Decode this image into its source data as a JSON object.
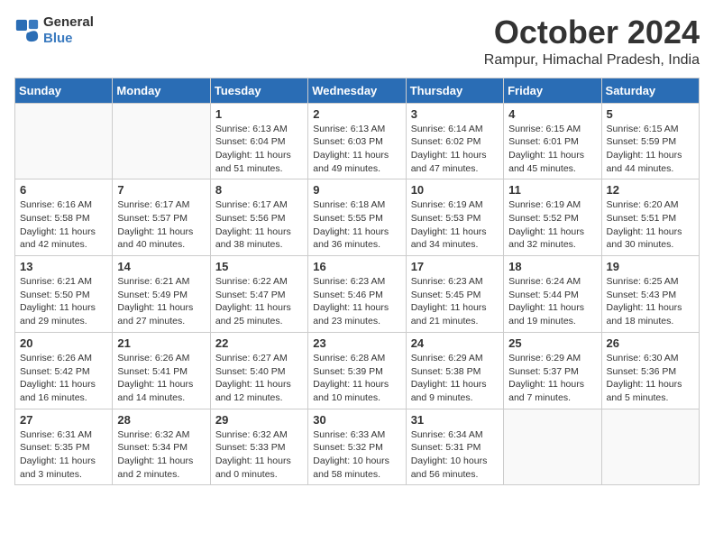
{
  "logo": {
    "text_general": "General",
    "text_blue": "Blue"
  },
  "header": {
    "title": "October 2024",
    "subtitle": "Rampur, Himachal Pradesh, India"
  },
  "weekdays": [
    "Sunday",
    "Monday",
    "Tuesday",
    "Wednesday",
    "Thursday",
    "Friday",
    "Saturday"
  ],
  "weeks": [
    [
      {
        "day": "",
        "info": ""
      },
      {
        "day": "",
        "info": ""
      },
      {
        "day": "1",
        "info": "Sunrise: 6:13 AM\nSunset: 6:04 PM\nDaylight: 11 hours and 51 minutes."
      },
      {
        "day": "2",
        "info": "Sunrise: 6:13 AM\nSunset: 6:03 PM\nDaylight: 11 hours and 49 minutes."
      },
      {
        "day": "3",
        "info": "Sunrise: 6:14 AM\nSunset: 6:02 PM\nDaylight: 11 hours and 47 minutes."
      },
      {
        "day": "4",
        "info": "Sunrise: 6:15 AM\nSunset: 6:01 PM\nDaylight: 11 hours and 45 minutes."
      },
      {
        "day": "5",
        "info": "Sunrise: 6:15 AM\nSunset: 5:59 PM\nDaylight: 11 hours and 44 minutes."
      }
    ],
    [
      {
        "day": "6",
        "info": "Sunrise: 6:16 AM\nSunset: 5:58 PM\nDaylight: 11 hours and 42 minutes."
      },
      {
        "day": "7",
        "info": "Sunrise: 6:17 AM\nSunset: 5:57 PM\nDaylight: 11 hours and 40 minutes."
      },
      {
        "day": "8",
        "info": "Sunrise: 6:17 AM\nSunset: 5:56 PM\nDaylight: 11 hours and 38 minutes."
      },
      {
        "day": "9",
        "info": "Sunrise: 6:18 AM\nSunset: 5:55 PM\nDaylight: 11 hours and 36 minutes."
      },
      {
        "day": "10",
        "info": "Sunrise: 6:19 AM\nSunset: 5:53 PM\nDaylight: 11 hours and 34 minutes."
      },
      {
        "day": "11",
        "info": "Sunrise: 6:19 AM\nSunset: 5:52 PM\nDaylight: 11 hours and 32 minutes."
      },
      {
        "day": "12",
        "info": "Sunrise: 6:20 AM\nSunset: 5:51 PM\nDaylight: 11 hours and 30 minutes."
      }
    ],
    [
      {
        "day": "13",
        "info": "Sunrise: 6:21 AM\nSunset: 5:50 PM\nDaylight: 11 hours and 29 minutes."
      },
      {
        "day": "14",
        "info": "Sunrise: 6:21 AM\nSunset: 5:49 PM\nDaylight: 11 hours and 27 minutes."
      },
      {
        "day": "15",
        "info": "Sunrise: 6:22 AM\nSunset: 5:47 PM\nDaylight: 11 hours and 25 minutes."
      },
      {
        "day": "16",
        "info": "Sunrise: 6:23 AM\nSunset: 5:46 PM\nDaylight: 11 hours and 23 minutes."
      },
      {
        "day": "17",
        "info": "Sunrise: 6:23 AM\nSunset: 5:45 PM\nDaylight: 11 hours and 21 minutes."
      },
      {
        "day": "18",
        "info": "Sunrise: 6:24 AM\nSunset: 5:44 PM\nDaylight: 11 hours and 19 minutes."
      },
      {
        "day": "19",
        "info": "Sunrise: 6:25 AM\nSunset: 5:43 PM\nDaylight: 11 hours and 18 minutes."
      }
    ],
    [
      {
        "day": "20",
        "info": "Sunrise: 6:26 AM\nSunset: 5:42 PM\nDaylight: 11 hours and 16 minutes."
      },
      {
        "day": "21",
        "info": "Sunrise: 6:26 AM\nSunset: 5:41 PM\nDaylight: 11 hours and 14 minutes."
      },
      {
        "day": "22",
        "info": "Sunrise: 6:27 AM\nSunset: 5:40 PM\nDaylight: 11 hours and 12 minutes."
      },
      {
        "day": "23",
        "info": "Sunrise: 6:28 AM\nSunset: 5:39 PM\nDaylight: 11 hours and 10 minutes."
      },
      {
        "day": "24",
        "info": "Sunrise: 6:29 AM\nSunset: 5:38 PM\nDaylight: 11 hours and 9 minutes."
      },
      {
        "day": "25",
        "info": "Sunrise: 6:29 AM\nSunset: 5:37 PM\nDaylight: 11 hours and 7 minutes."
      },
      {
        "day": "26",
        "info": "Sunrise: 6:30 AM\nSunset: 5:36 PM\nDaylight: 11 hours and 5 minutes."
      }
    ],
    [
      {
        "day": "27",
        "info": "Sunrise: 6:31 AM\nSunset: 5:35 PM\nDaylight: 11 hours and 3 minutes."
      },
      {
        "day": "28",
        "info": "Sunrise: 6:32 AM\nSunset: 5:34 PM\nDaylight: 11 hours and 2 minutes."
      },
      {
        "day": "29",
        "info": "Sunrise: 6:32 AM\nSunset: 5:33 PM\nDaylight: 11 hours and 0 minutes."
      },
      {
        "day": "30",
        "info": "Sunrise: 6:33 AM\nSunset: 5:32 PM\nDaylight: 10 hours and 58 minutes."
      },
      {
        "day": "31",
        "info": "Sunrise: 6:34 AM\nSunset: 5:31 PM\nDaylight: 10 hours and 56 minutes."
      },
      {
        "day": "",
        "info": ""
      },
      {
        "day": "",
        "info": ""
      }
    ]
  ]
}
